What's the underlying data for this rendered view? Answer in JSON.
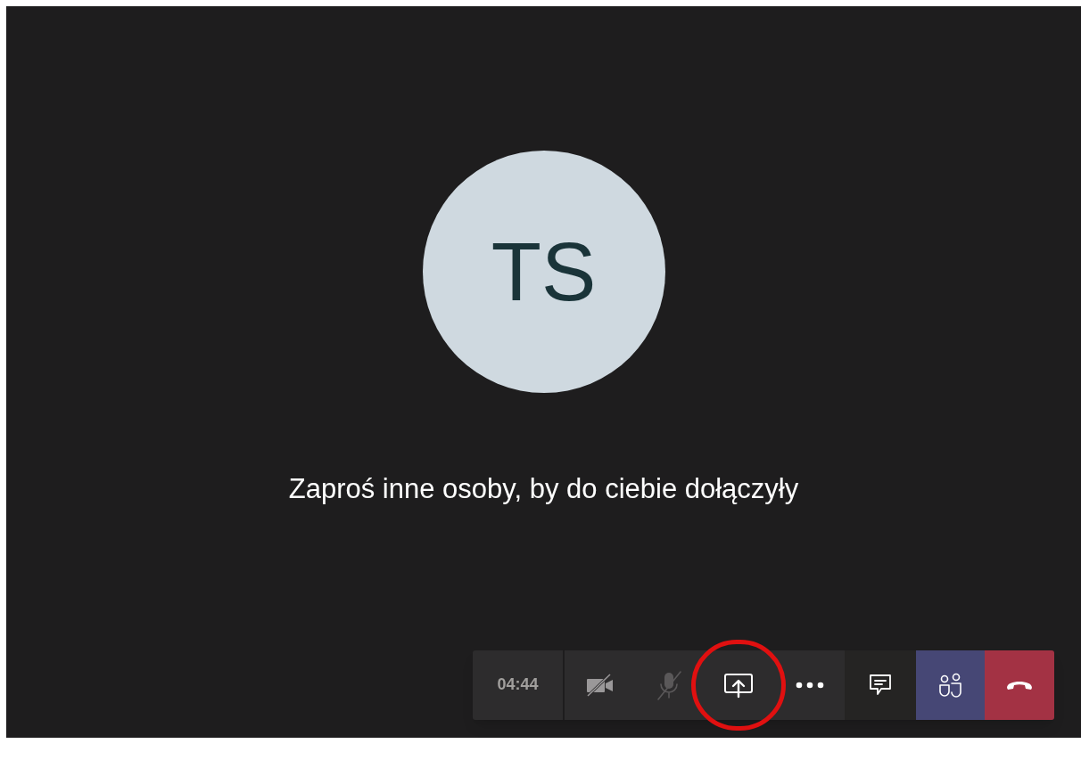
{
  "avatar": {
    "initials": "TS"
  },
  "message": "Zaproś inne osoby, by do ciebie dołączyły",
  "toolbar": {
    "timer": "04:44",
    "controls": [
      {
        "kind": "camera",
        "disabled": false,
        "selected": false,
        "annotated": false
      },
      {
        "kind": "mic",
        "disabled": true,
        "selected": false,
        "annotated": false
      },
      {
        "kind": "share",
        "disabled": false,
        "selected": false,
        "annotated": true
      },
      {
        "kind": "more",
        "disabled": false,
        "selected": false,
        "annotated": false
      },
      {
        "kind": "chat",
        "disabled": false,
        "selected": false,
        "annotated": false
      },
      {
        "kind": "people",
        "disabled": false,
        "selected": true,
        "annotated": false
      },
      {
        "kind": "hangup",
        "disabled": false,
        "selected": false,
        "annotated": false
      }
    ]
  }
}
